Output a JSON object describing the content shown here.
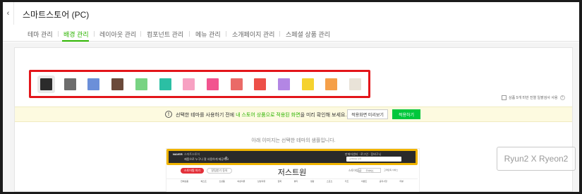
{
  "header": {
    "back_icon": "chevron-left-icon",
    "back_glyph": "‹",
    "title": "스마트스토어 (PC)"
  },
  "tabs": [
    {
      "label": "테마 관리",
      "active": false
    },
    {
      "label": "배경 관리",
      "active": true
    },
    {
      "label": "레이아웃 관리",
      "active": false
    },
    {
      "label": "컴포넌트 관리",
      "active": false
    },
    {
      "label": "메뉴 관리",
      "active": false
    },
    {
      "label": "소개페이지 관리",
      "active": false
    },
    {
      "label": "스페셜 상품 관리",
      "active": false
    }
  ],
  "background_colors": [
    {
      "color": "#2b2b2b",
      "selected": true
    },
    {
      "color": "#6d6d6d",
      "selected": false
    },
    {
      "color": "#6b8fd9",
      "selected": false
    },
    {
      "color": "#6b4a3a",
      "selected": false
    },
    {
      "color": "#78d383",
      "selected": false
    },
    {
      "color": "#2bbfa4",
      "selected": false
    },
    {
      "color": "#f7a1c2",
      "selected": false
    },
    {
      "color": "#f2548f",
      "selected": false
    },
    {
      "color": "#ea6a67",
      "selected": false
    },
    {
      "color": "#ed4f48",
      "selected": false
    },
    {
      "color": "#b386e4",
      "selected": false
    },
    {
      "color": "#f5d22f",
      "selected": false
    },
    {
      "color": "#f5a049",
      "selected": false
    },
    {
      "color": "#e9e3d8",
      "selected": false
    }
  ],
  "highlight_color": "#e3151a",
  "accent_color": "#2db400",
  "option_checkbox": {
    "label": "상품 5개 미만 진열 일괄검사 사용",
    "help_icon": "question-icon",
    "help_glyph": "?"
  },
  "notice": {
    "icon": "info-icon",
    "glyph": "!",
    "text_before": "선택한 테마를 사용하기 전에 ",
    "text_highlight": "내 스토어 상품으로 적용된 화면",
    "text_after": "을 미리 확인해 보세요.",
    "preview_button": "적용화면 미리보기",
    "apply_button": "적용하기"
  },
  "preview": {
    "caption": "아래 이미지는 선택한 테마의 샘플입니다.",
    "logo": "NAVER",
    "brand": "스마트스토어",
    "slogan": "제품으로 누구나 잘 사용하게 제공해요",
    "top_links": "판매자센터   ·   로그인   ·   장바구니",
    "search_placeholder": "검색어를 입력",
    "search_icon": "search-icon",
    "search_glyph": "⌕",
    "follow_button": "스토어찜 하기",
    "alert_button": "알림받기 동의",
    "store_name": "저스트원",
    "grade_label": "스토어등급",
    "grade_badge": "굿서비스",
    "service_label": "고객만족 서비스",
    "menu": [
      "전체상품",
      "베스트",
      "신상품",
      "여성의류",
      "남성의류",
      "잡화",
      "뷰티",
      "생활",
      "스포츠",
      "키즈",
      "이벤트",
      "공지사항",
      "리뷰"
    ]
  },
  "watermark": "Ryun2 X Ryeon2"
}
